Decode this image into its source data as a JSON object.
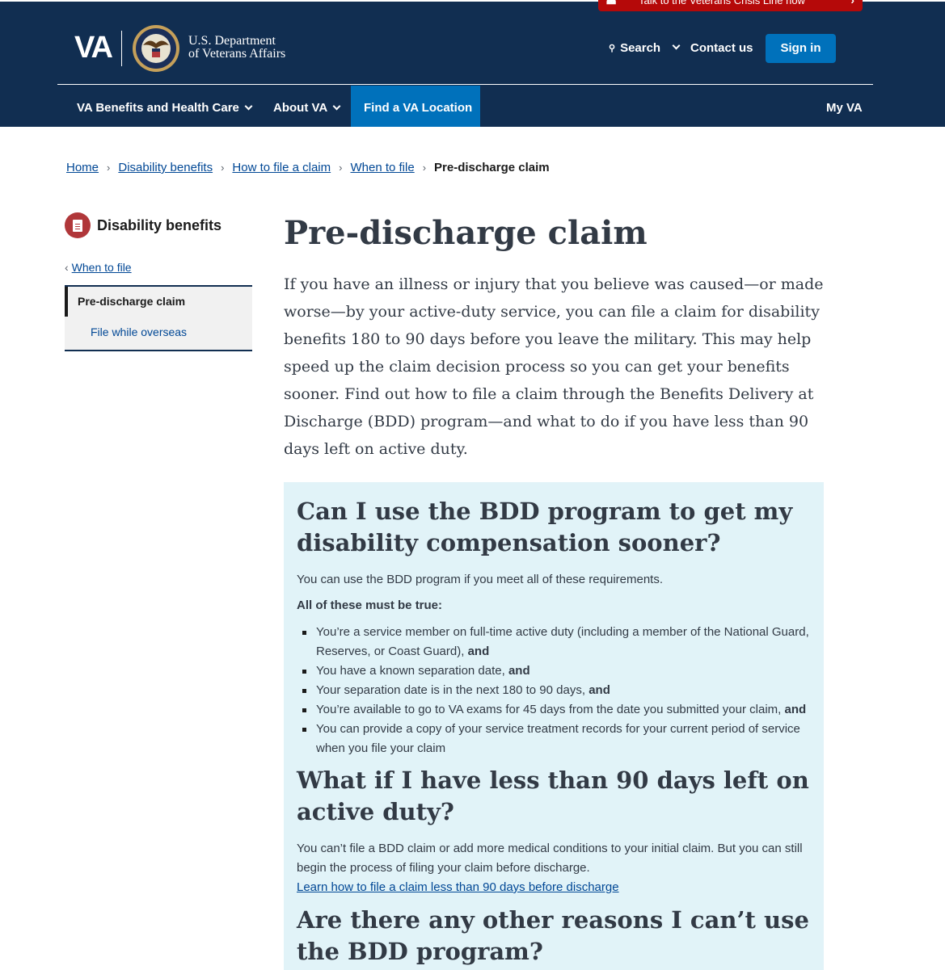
{
  "header": {
    "crisis_text": "Talk to the Veterans Crisis Line now",
    "logo_text": "VA",
    "dept_line1": "U.S. Department",
    "dept_line2": "of Veterans Affairs",
    "search_label": "Search",
    "contact_label": "Contact us",
    "signin_label": "Sign in",
    "nav": {
      "benefits": "VA Benefits and Health Care",
      "about": "About VA",
      "find": "Find a VA Location",
      "myva": "My VA"
    }
  },
  "breadcrumb": {
    "home": "Home",
    "disability": "Disability benefits",
    "how_to_file": "How to file a claim",
    "when_to_file": "When to file",
    "current": "Pre-discharge claim"
  },
  "sidenav": {
    "title": "Disability benefits",
    "back_link": "When to file",
    "current": "Pre-discharge claim",
    "sub_item": "File while overseas"
  },
  "main": {
    "title": "Pre-discharge claim",
    "intro": "If you have an illness or injury that you believe was caused—or made worse—by your active-duty service, you can file a claim for disability benefits 180 to 90 days before you leave the military. This may help speed up the claim decision process so you can get your benefits sooner. Find out how to file a claim through the Benefits Delivery at Discharge (BDD) program—and what to do if you have less than 90 days left on active duty.",
    "section1": {
      "heading": "Can I use the BDD program to get my disability compensation sooner?",
      "lead": "You can use the BDD program if you meet all of these requirements.",
      "must_be_true": "All of these must be true:",
      "items": [
        {
          "text": "You’re a service member on full-time active duty (including a member of the National Guard, Reserves, or Coast Guard),",
          "suffix": "and"
        },
        {
          "text": "You have a known separation date,",
          "suffix": "and"
        },
        {
          "text": "Your separation date is in the next 180 to 90 days,",
          "suffix": "and"
        },
        {
          "text": "You’re available to go to VA exams for 45 days from the date you submitted your claim,",
          "suffix": "and"
        },
        {
          "text": "You can provide a copy of your service treatment records for your current period of service when you file your claim",
          "suffix": ""
        }
      ]
    },
    "section2": {
      "heading": "What if I have less than 90 days left on active duty?",
      "body": "You can’t file a BDD claim or add more medical conditions to your initial claim. But you can still begin the process of filing your claim before discharge.",
      "link": "Learn how to file a claim less than 90 days before discharge"
    },
    "section3": {
      "heading": "Are there any other reasons I can’t use the BDD program?"
    }
  },
  "colors": {
    "header_bg": "#112e51",
    "accent_blue": "#0071bb",
    "crisis_red": "#b50909",
    "panel_bg": "#e1f3f8",
    "link": "#004795"
  }
}
